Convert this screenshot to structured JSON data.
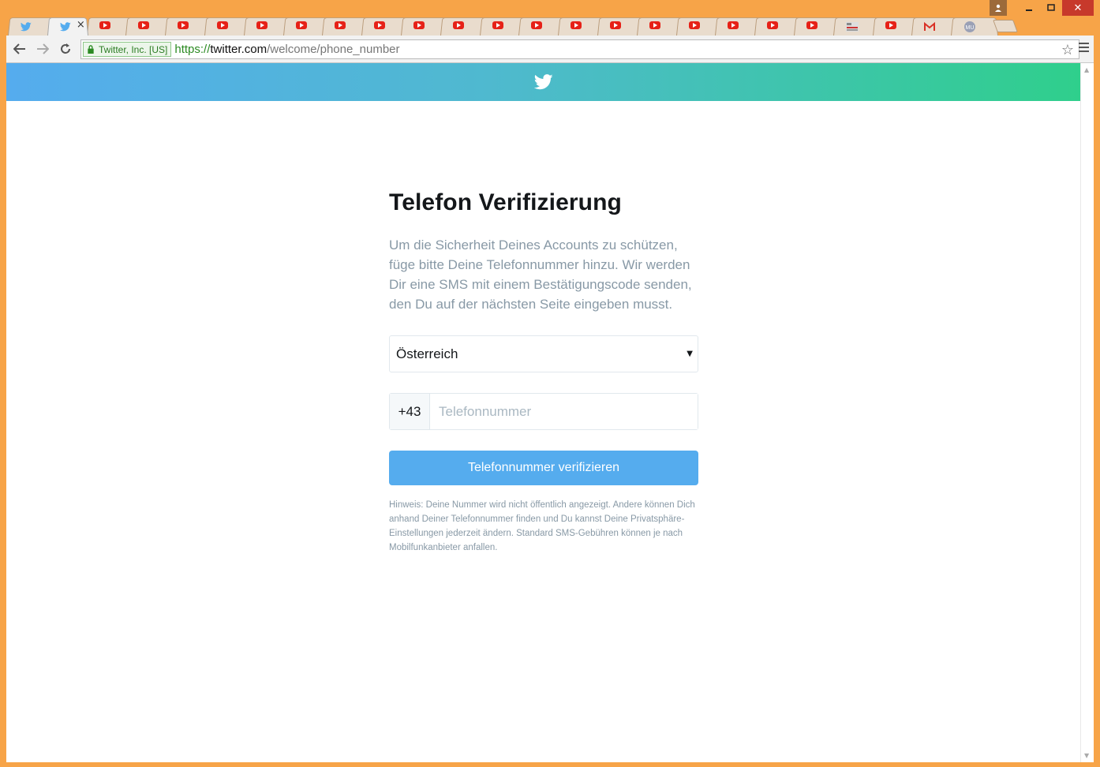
{
  "browser": {
    "tabs": [
      {
        "icon": "twitter-icon",
        "active": false
      },
      {
        "icon": "twitter-icon",
        "active": true,
        "close": "×"
      },
      {
        "icon": "youtube-icon"
      },
      {
        "icon": "youtube-icon"
      },
      {
        "icon": "youtube-icon"
      },
      {
        "icon": "youtube-icon"
      },
      {
        "icon": "youtube-icon"
      },
      {
        "icon": "youtube-icon"
      },
      {
        "icon": "youtube-icon"
      },
      {
        "icon": "youtube-icon"
      },
      {
        "icon": "youtube-icon"
      },
      {
        "icon": "youtube-icon"
      },
      {
        "icon": "youtube-icon"
      },
      {
        "icon": "youtube-icon"
      },
      {
        "icon": "youtube-icon"
      },
      {
        "icon": "youtube-icon"
      },
      {
        "icon": "youtube-icon"
      },
      {
        "icon": "youtube-icon"
      },
      {
        "icon": "youtube-icon"
      },
      {
        "icon": "youtube-icon"
      },
      {
        "icon": "youtube-icon"
      },
      {
        "icon": "news-icon"
      },
      {
        "icon": "youtube-icon"
      },
      {
        "icon": "gmail-icon"
      },
      {
        "icon": "mu-icon",
        "text": "MU"
      }
    ],
    "ev_label": "Twitter, Inc. [US]",
    "url": {
      "scheme": "https://",
      "host": "twitter.com",
      "path": "/welcome/phone_number"
    }
  },
  "page": {
    "title": "Telefon Verifizierung",
    "description": "Um die Sicherheit Deines Accounts zu schützen, füge bitte Deine Telefonnummer hinzu. Wir werden Dir eine SMS mit einem Bestätigungscode senden, den Du auf der nächsten Seite eingeben musst.",
    "country_select": {
      "selected": "Österreich"
    },
    "phone": {
      "country_code": "+43",
      "value": "",
      "placeholder": "Telefonnummer"
    },
    "verify_button": "Telefonnummer verifizieren",
    "hint": "Hinweis: Deine Nummer wird nicht öffentlich angezeigt. Andere können Dich anhand Deiner Telefonnummer finden und Du kannst Deine Privatsphäre-Einstellungen jederzeit ändern. Standard SMS-Gebühren können je nach Mobilfunkanbieter anfallen."
  },
  "colors": {
    "twitter_blue": "#55acee",
    "gradient_end": "#2fcf8c",
    "window_frame": "#f7a448"
  }
}
